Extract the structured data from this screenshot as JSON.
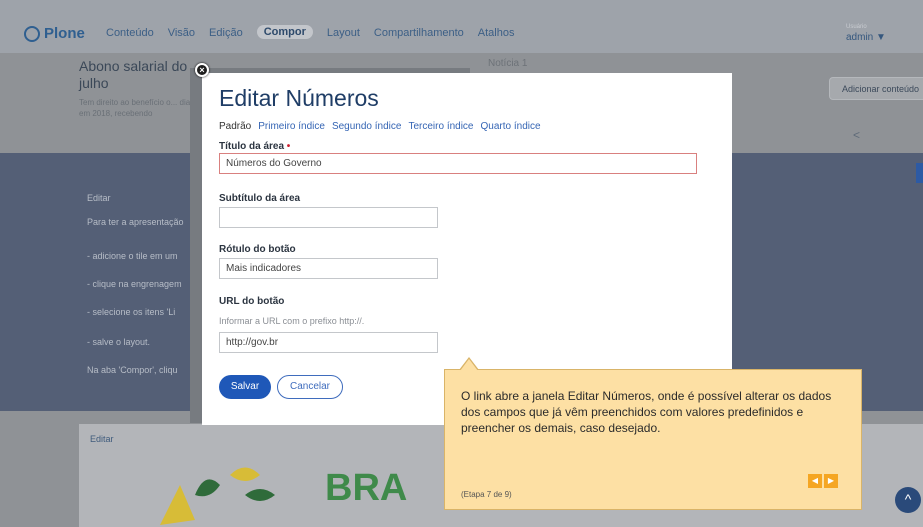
{
  "app": {
    "logo_text": "Plone",
    "menu": [
      "Conteúdo",
      "Visão",
      "Edição",
      "Compor",
      "Layout",
      "Compartilhamento",
      "Atalhos"
    ],
    "active_menu": "Compor",
    "user_label": "Usuário",
    "user": "admin ▼"
  },
  "background": {
    "news_title": "Abono salarial do julho",
    "news_desc": "Tem direito ao benefício o... dias em 2018, recebendo",
    "noticia": "Notícia 1",
    "add_content": "Adicionar conteúdo",
    "band_lines": [
      "Editar",
      "Para ter a apresentação",
      "- adicione o tile em um",
      "- clique na engrenagem",
      "- selecione os itens 'Li",
      "- salve o layout.",
      "Na aba 'Compor', cliqu"
    ],
    "editar_bottom": "Editar",
    "brand_text": "BRA"
  },
  "modal": {
    "title": "Editar Números",
    "tabs": [
      "Padrão",
      "Primeiro índice",
      "Segundo índice",
      "Terceiro índice",
      "Quarto índice"
    ],
    "active_tab": "Padrão",
    "fields": {
      "titulo_label": "Título da área",
      "titulo_required": "•",
      "titulo_value": "Números do Governo",
      "subtitulo_label": "Subtítulo da área",
      "subtitulo_value": "",
      "rotulo_label": "Rótulo do botão",
      "rotulo_value": "Mais indicadores",
      "url_label": "URL do botão",
      "url_help": "Informar a URL com o prefixo http://.",
      "url_value": "http://gov.br"
    },
    "save_label": "Salvar",
    "cancel_label": "Cancelar"
  },
  "tooltip": {
    "text": "O link abre a janela Editar Números, onde é possível alterar os dados dos campos que já vêm preenchidos com valores predefinidos e preencher os demais, caso desejado.",
    "step": "(Etapa 7 de 9)",
    "prev": "◀",
    "next": "▶"
  },
  "icons": {
    "close": "close-icon",
    "share": "share-icon",
    "up": "chevron-up-icon",
    "plone": "plone-logo-icon"
  }
}
